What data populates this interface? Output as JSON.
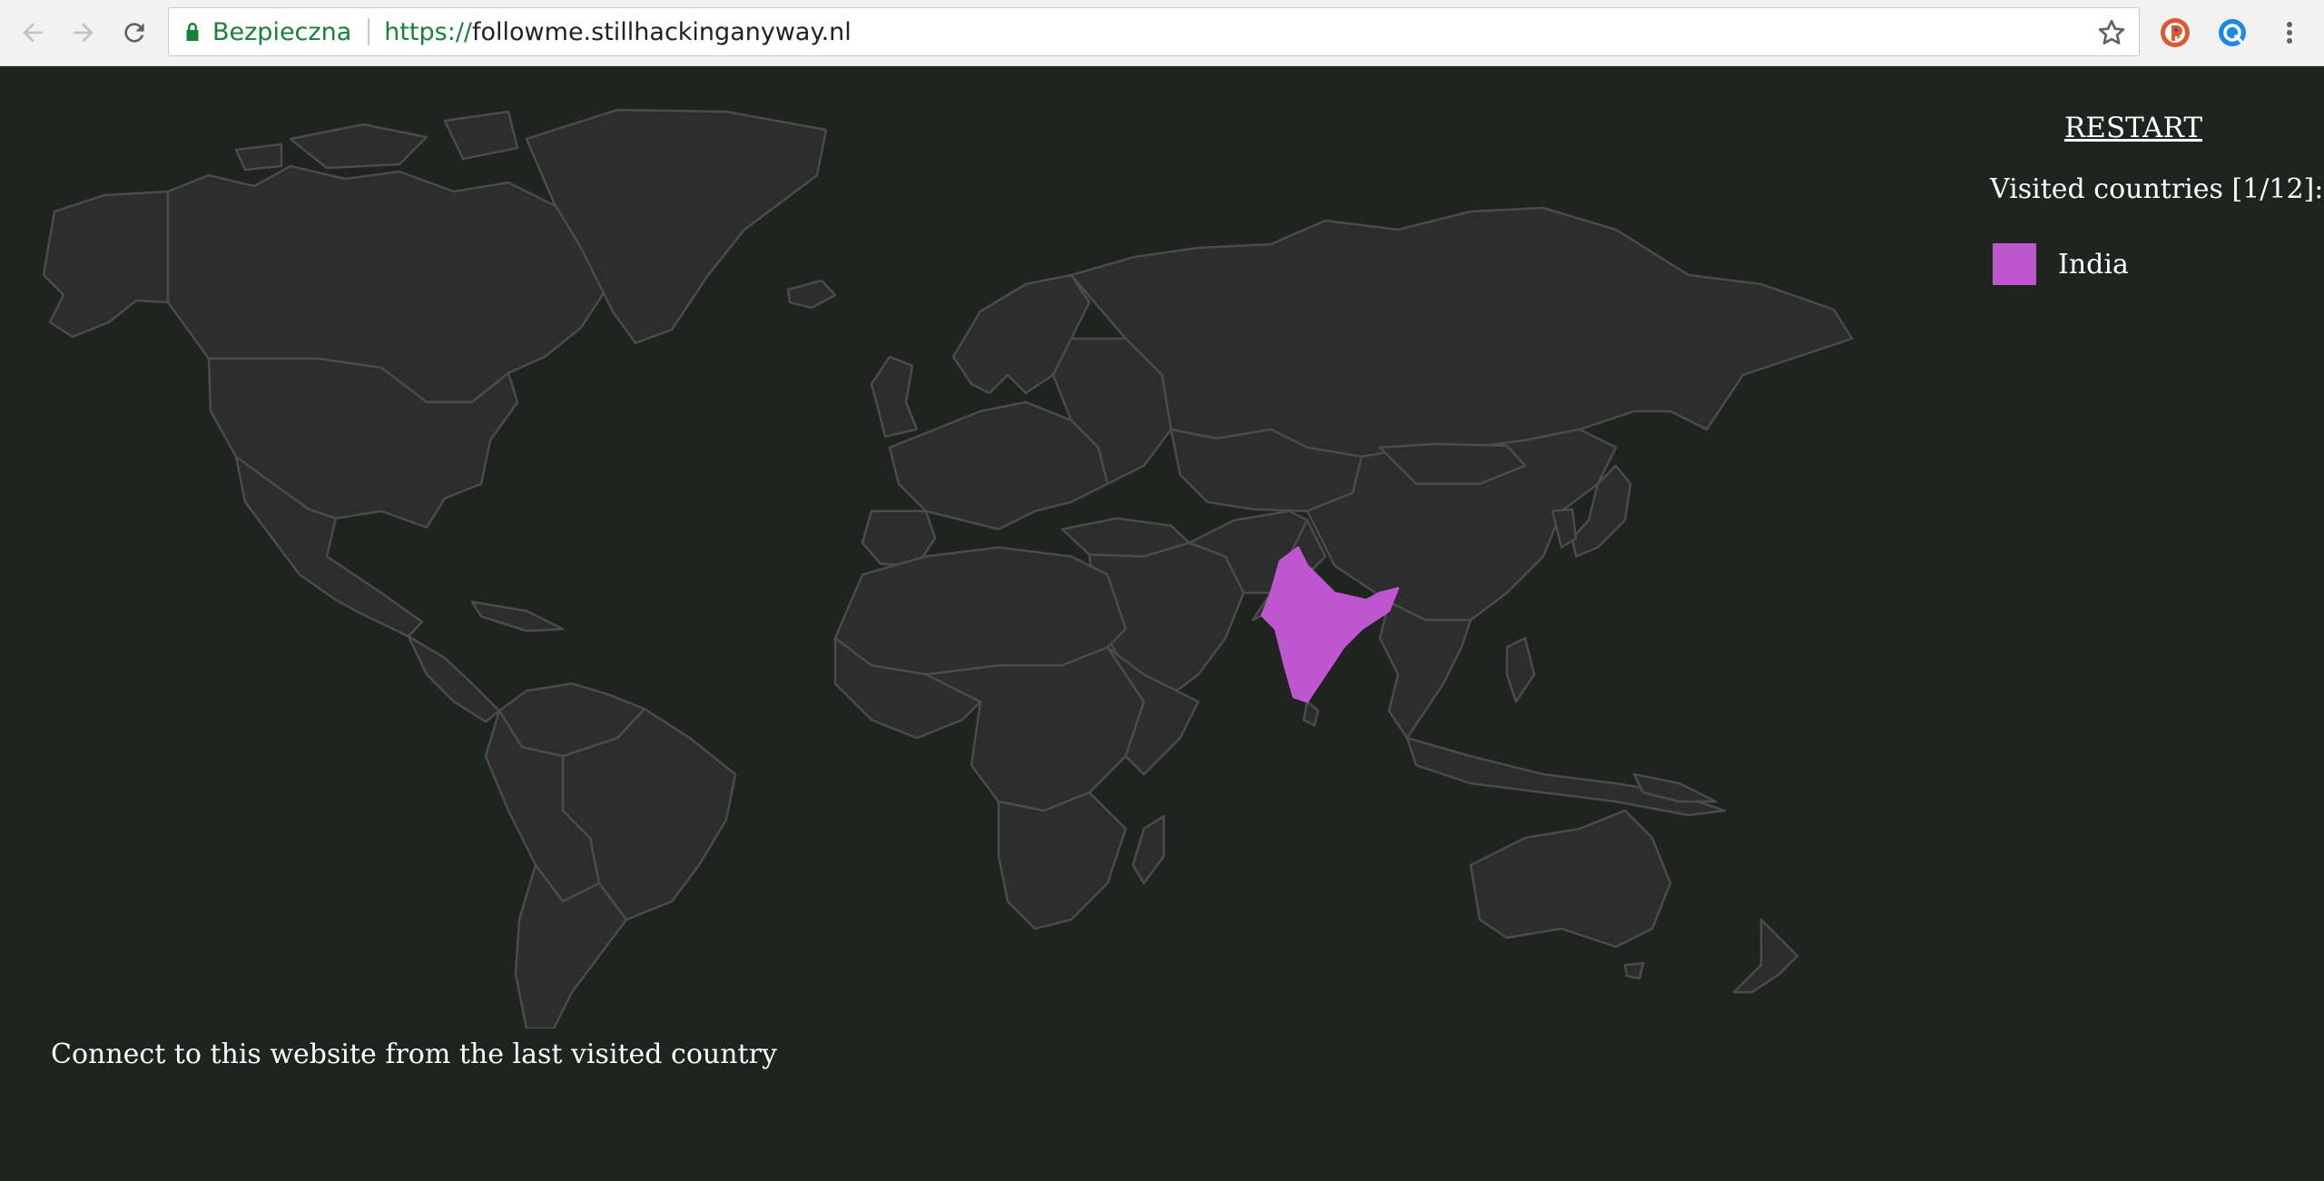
{
  "browser": {
    "security_label": "Bezpieczna",
    "url_scheme": "https://",
    "url_host": "followme.stillhackinganyway.nl",
    "icons": [
      "back-icon",
      "forward-icon",
      "reload-icon",
      "lock-icon",
      "star-icon",
      "duckduckgo-icon",
      "extension-icon",
      "menu-icon"
    ]
  },
  "sidebar": {
    "restart_label": "RESTART",
    "visited_title": "Visited countries [1/12]:",
    "visited": [
      {
        "name": "India",
        "color": "#be56cf"
      }
    ]
  },
  "instruction": "Connect to this website from the last visited country",
  "colors": {
    "background": "#202420",
    "land": "#2d2d2d",
    "border": "#4b4b4b",
    "highlight": "#be56cf"
  }
}
